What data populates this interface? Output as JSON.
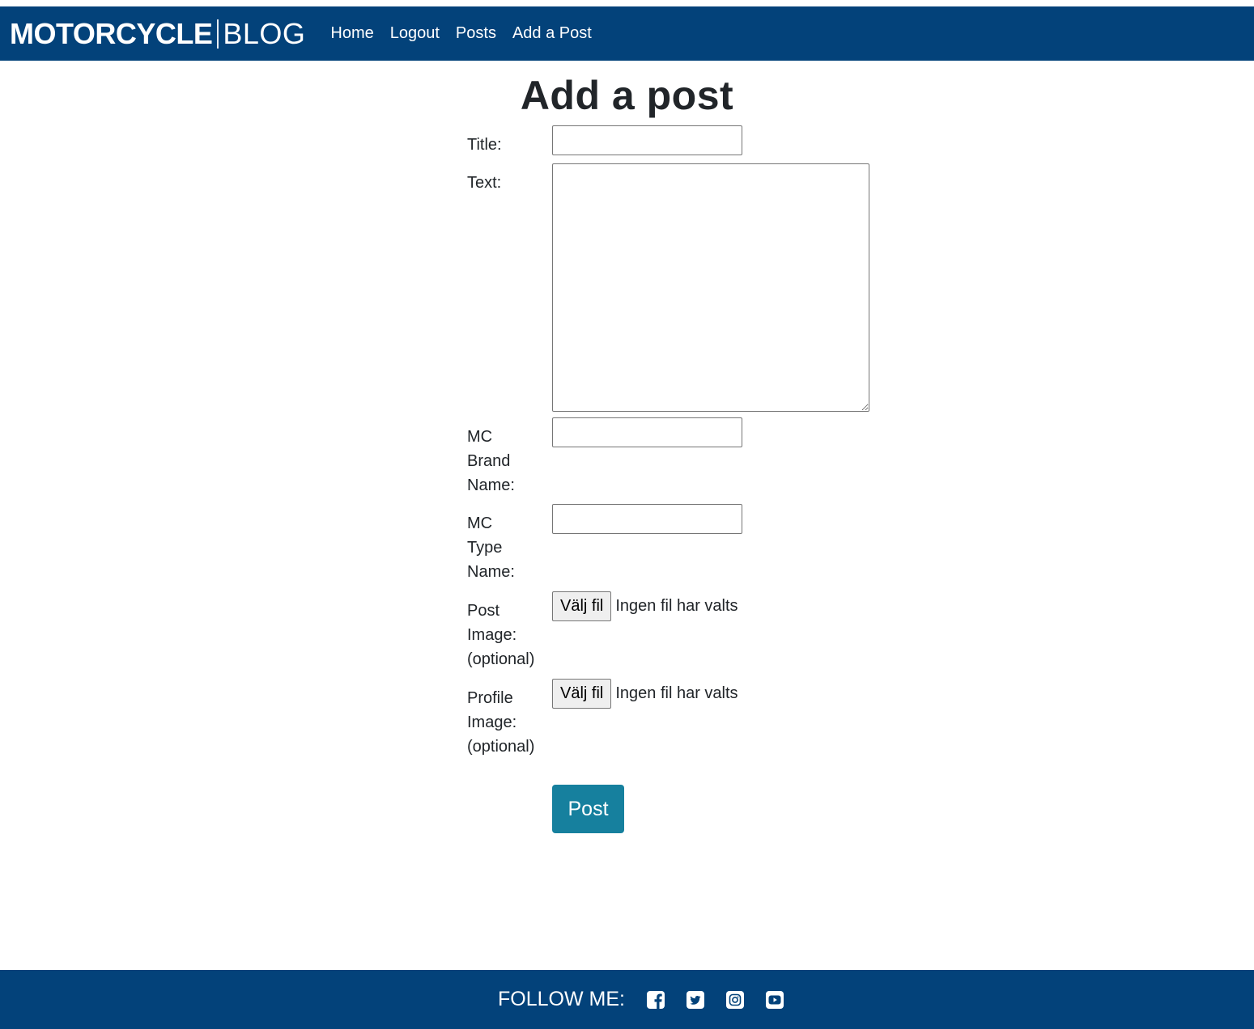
{
  "header": {
    "brand_bold": "MOTORCYCLE",
    "brand_light": "BLOG",
    "nav": {
      "home": "Home",
      "logout": "Logout",
      "posts": "Posts",
      "add_post": "Add a Post"
    }
  },
  "main": {
    "title": "Add a post",
    "form": {
      "title_label": "Title:",
      "text_label": "Text:",
      "brand_label_1": "MC",
      "brand_label_2": "Brand",
      "brand_label_3": "Name:",
      "type_label_1": "MC",
      "type_label_2": "Type",
      "type_label_3": "Name:",
      "post_image_label_1": "Post",
      "post_image_label_2": "Image:",
      "post_image_label_3": "(optional)",
      "profile_image_label_1": "Profile",
      "profile_image_label_2": "Image:",
      "profile_image_label_3": "(optional)",
      "file_button": "Välj fil",
      "file_status": "Ingen fil har valts",
      "submit": "Post"
    }
  },
  "footer": {
    "follow": "FOLLOW ME:",
    "icons": [
      "facebook-icon",
      "twitter-icon",
      "instagram-icon",
      "youtube-icon"
    ]
  },
  "colors": {
    "nav_bg": "#03427a",
    "button": "#16809e"
  }
}
